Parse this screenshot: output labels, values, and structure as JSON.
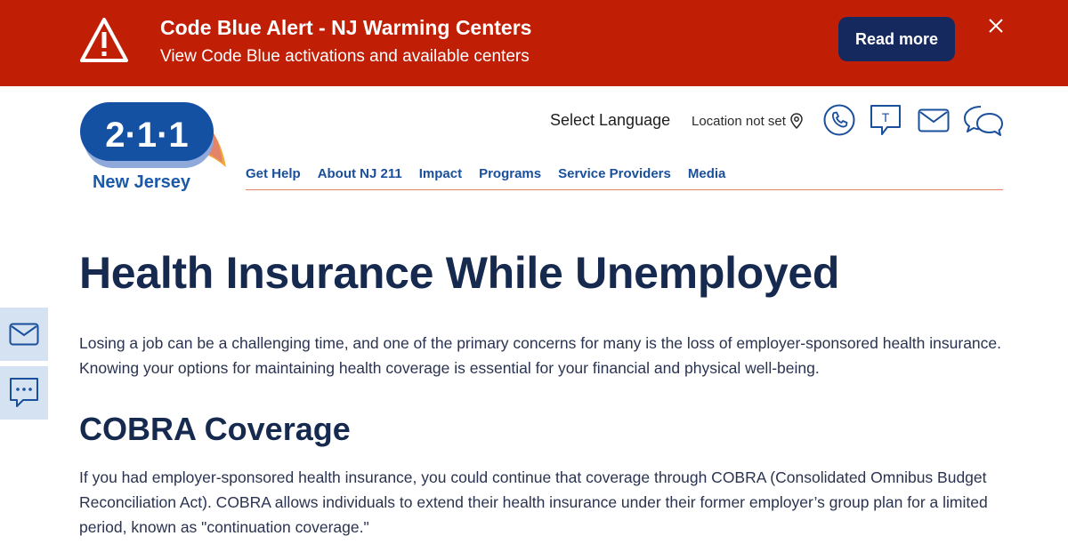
{
  "alert": {
    "title": "Code Blue Alert - NJ Warming Centers",
    "subtitle": "View Code Blue activations and available centers",
    "read_more_label": "Read more",
    "icon": "warning-triangle-icon",
    "close_icon": "close-icon",
    "background_color": "#c01f05",
    "button_color": "#15295e"
  },
  "header": {
    "logo_number": "2·1·1",
    "logo_text": "New Jersey",
    "select_language": "Select Language",
    "location": "Location not set",
    "icons": [
      "phone-icon",
      "text-message-icon",
      "email-icon",
      "chat-icon"
    ]
  },
  "nav": {
    "items": [
      {
        "label": "Get Help"
      },
      {
        "label": "About NJ 211"
      },
      {
        "label": "Impact"
      },
      {
        "label": "Programs"
      },
      {
        "label": "Service Providers"
      },
      {
        "label": "Media"
      }
    ],
    "color": "#1a4f9c"
  },
  "main": {
    "title": "Health Insurance While Unemployed",
    "intro": "Losing a job can be a challenging time, and one of the primary concerns for many is the loss of employer-sponsored health insurance. Knowing your options for maintaining health coverage is essential for your financial and physical well-being.",
    "section_title": "COBRA Coverage",
    "section_text": "If you had employer-sponsored health insurance, you could continue that coverage through COBRA (Consolidated Omnibus Budget Reconciliation Act). COBRA allows individuals to extend their health insurance under their former employer’s group plan for a limited period, known as \"continuation coverage.\""
  },
  "side_tabs": [
    "email-icon",
    "chat-icon"
  ]
}
